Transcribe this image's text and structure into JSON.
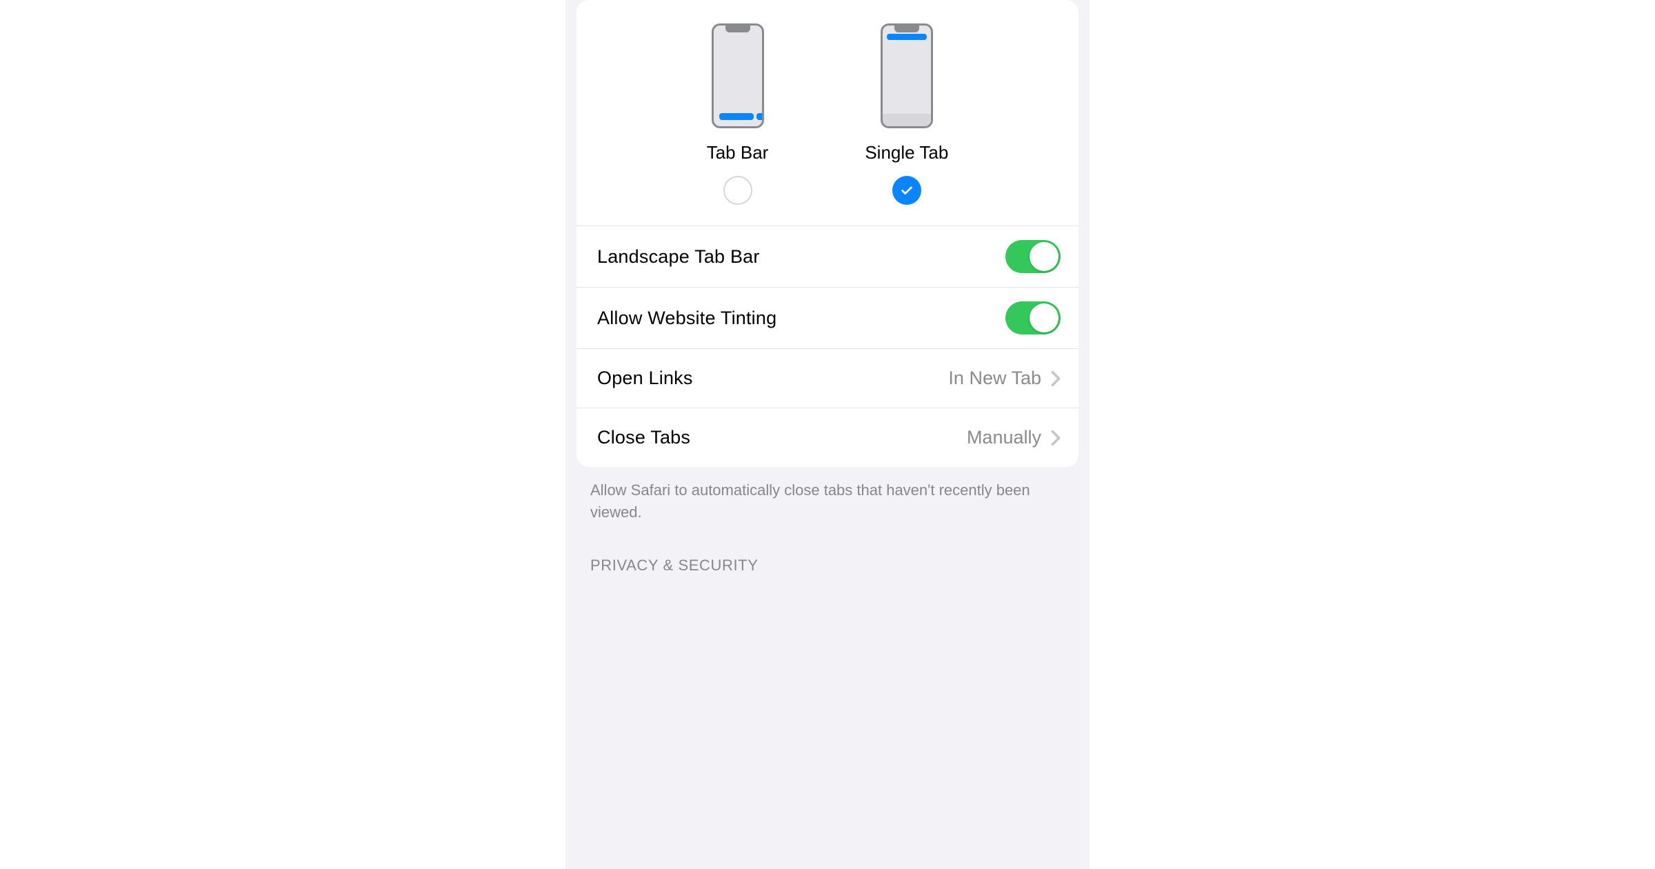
{
  "layout_options": {
    "tab_bar": {
      "label": "Tab Bar",
      "selected": false
    },
    "single_tab": {
      "label": "Single Tab",
      "selected": true
    }
  },
  "rows": {
    "landscape_tab_bar": {
      "label": "Landscape Tab Bar",
      "enabled": true
    },
    "allow_website_tinting": {
      "label": "Allow Website Tinting",
      "enabled": true
    },
    "open_links": {
      "label": "Open Links",
      "value": "In New Tab"
    },
    "close_tabs": {
      "label": "Close Tabs",
      "value": "Manually"
    }
  },
  "footer": "Allow Safari to automatically close tabs that haven't recently been viewed.",
  "section_header": "Privacy & Security",
  "colors": {
    "accent": "#0a84ff",
    "switch_on": "#34c759"
  }
}
